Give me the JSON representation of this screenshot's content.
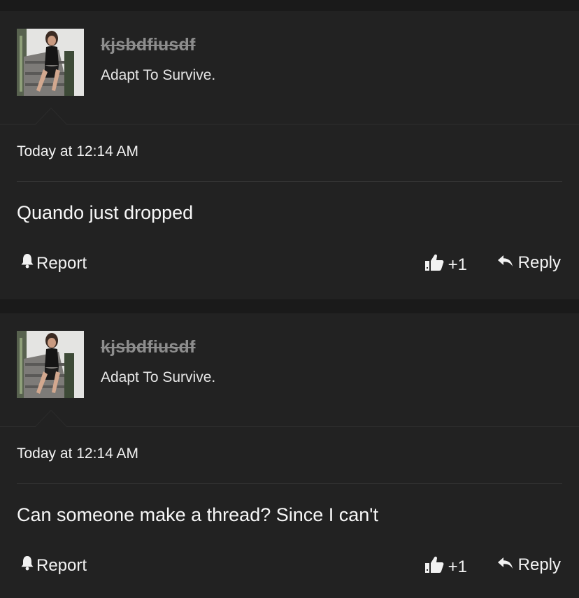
{
  "posts": [
    {
      "username": "kjsbdfiusdf",
      "user_title": "Adapt To Survive.",
      "date": "Today at 12:14 AM",
      "message": "Quando just dropped",
      "actions": {
        "report": "Report",
        "like": "+1",
        "reply": "Reply"
      }
    },
    {
      "username": "kjsbdfiusdf",
      "user_title": "Adapt To Survive.",
      "date": "Today at 12:14 AM",
      "message": "Can someone make a thread? Since I can't",
      "actions": {
        "report": "Report",
        "like": "+1",
        "reply": "Reply"
      }
    }
  ],
  "icons": [
    "bell-icon",
    "thumbs-up-icon",
    "reply-arrow-icon"
  ]
}
